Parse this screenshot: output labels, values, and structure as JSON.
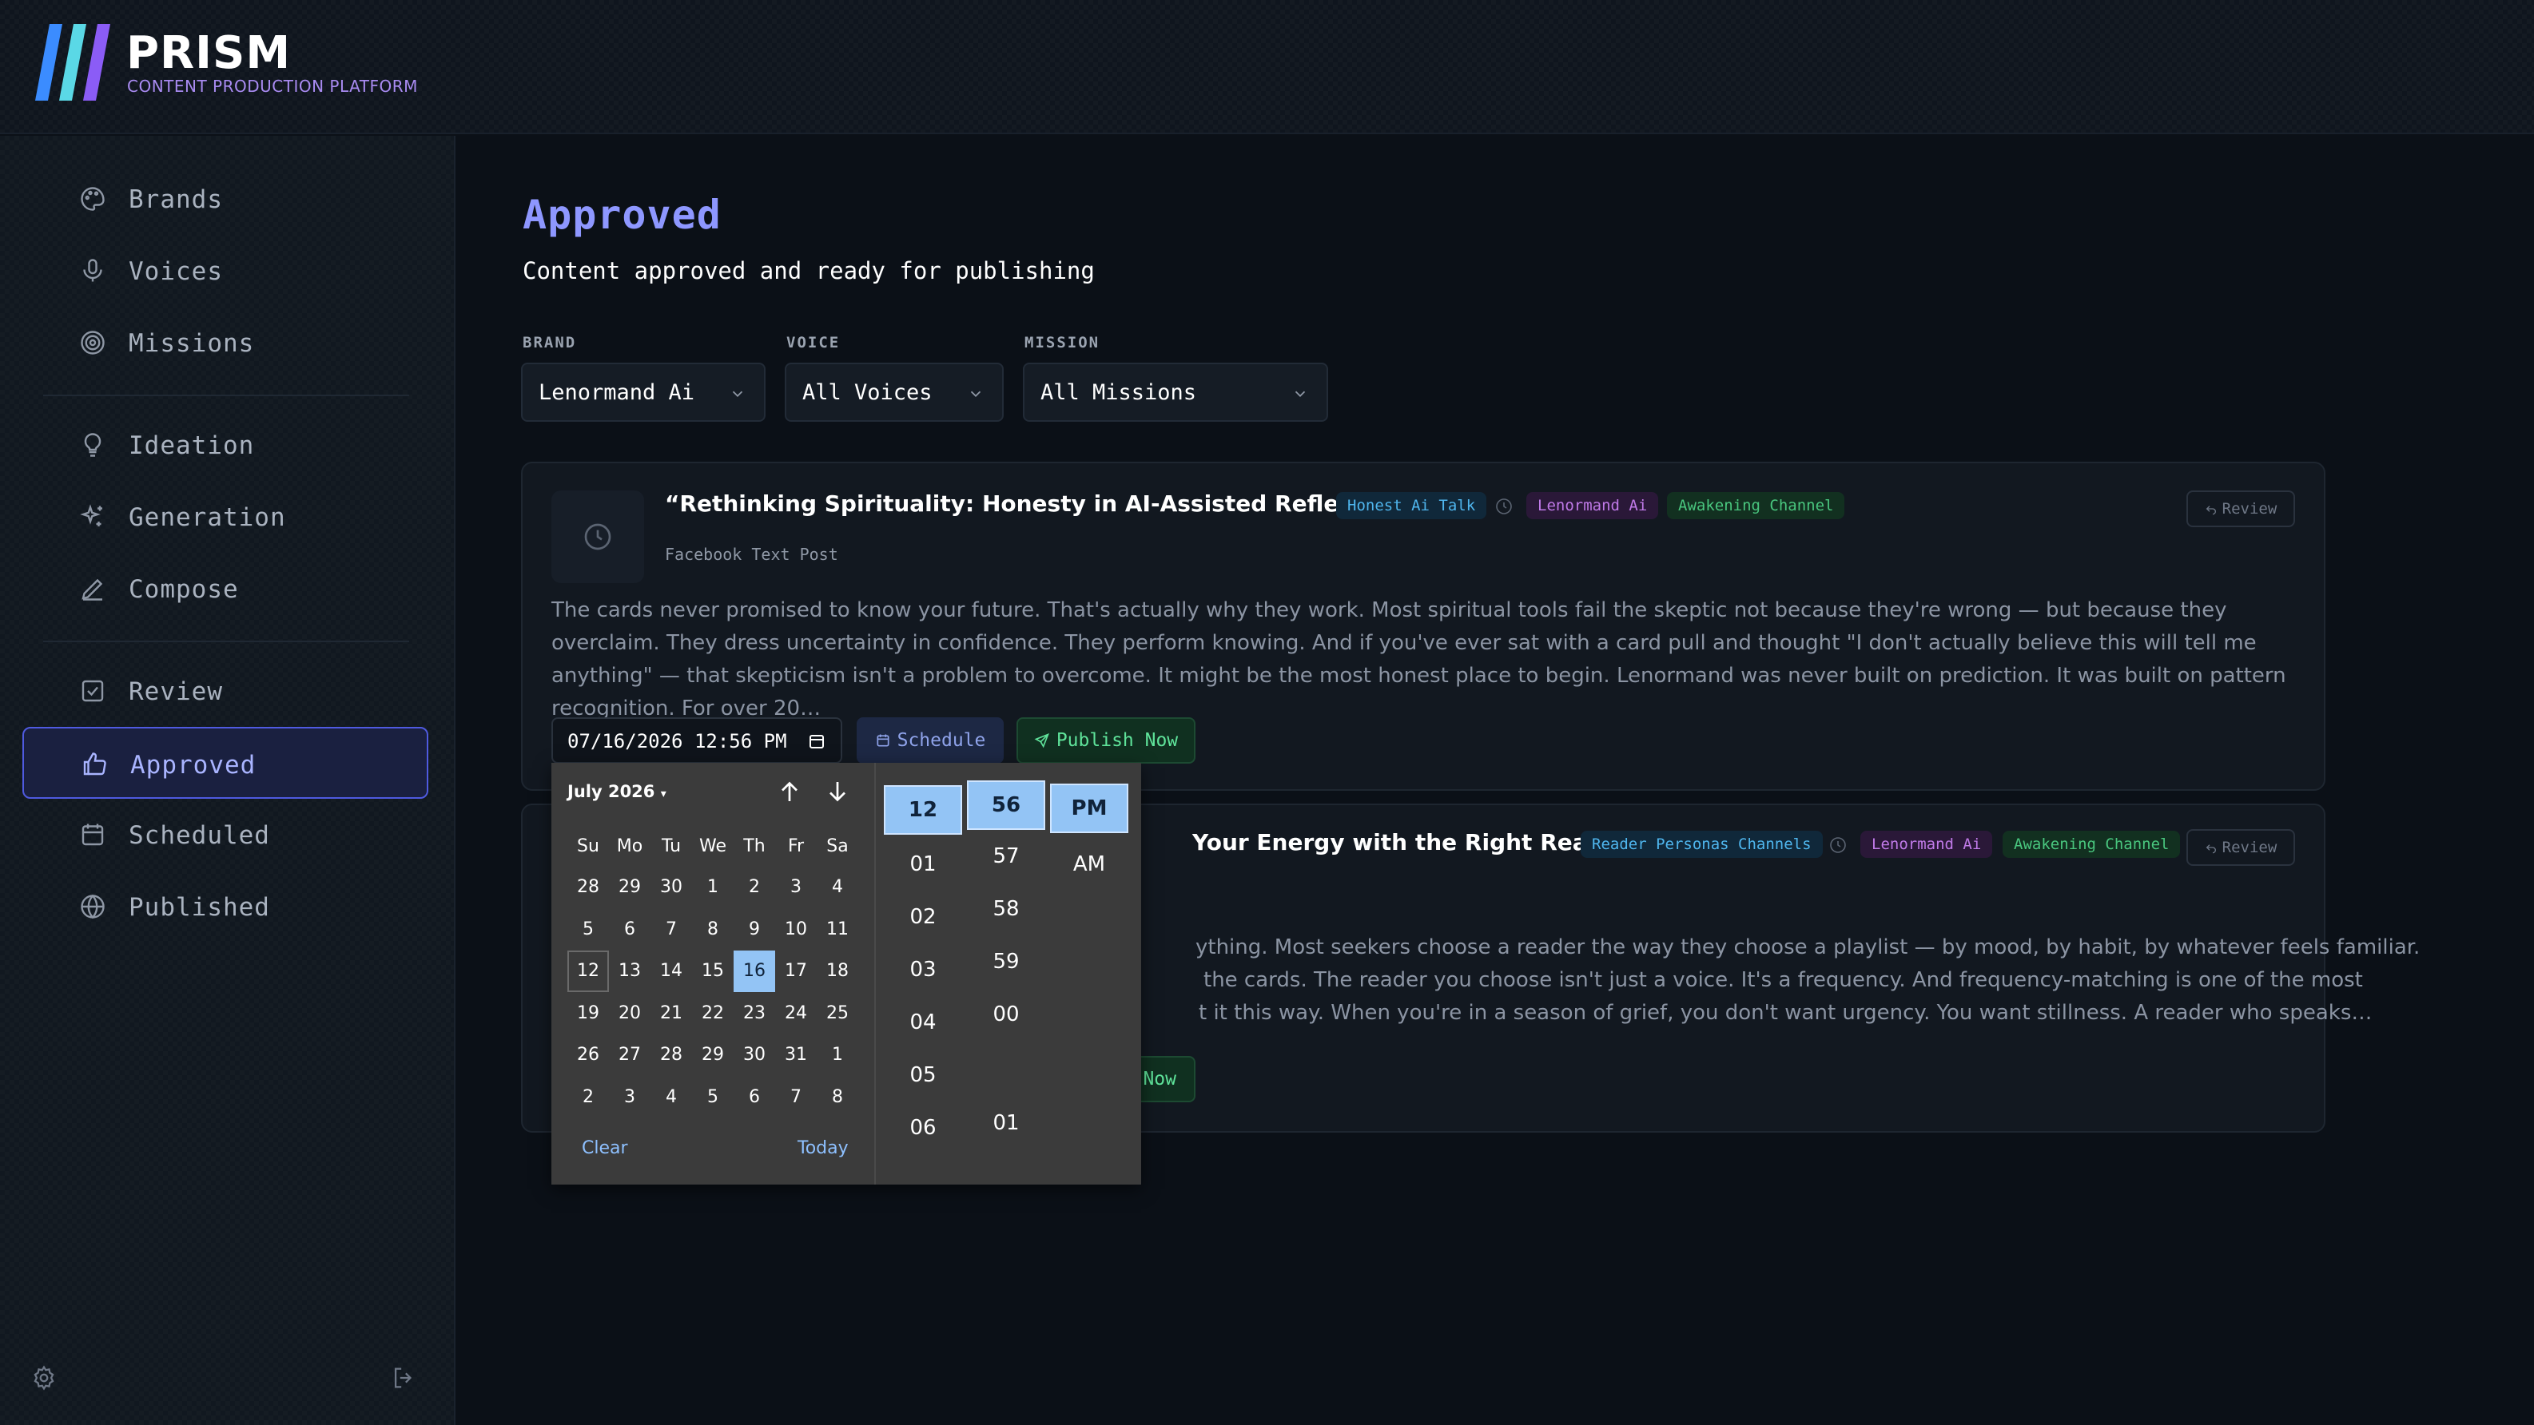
{
  "brand": {
    "title": "PRISM",
    "subtitle": "CONTENT PRODUCTION PLATFORM",
    "colors": [
      "#3b8cff",
      "#5ad8e6",
      "#8b5cf6"
    ]
  },
  "sidebar": {
    "items": [
      {
        "label": "Brands",
        "icon": "palette-icon"
      },
      {
        "label": "Voices",
        "icon": "microphone-icon"
      },
      {
        "label": "Missions",
        "icon": "target-icon"
      },
      {
        "label": "Ideation",
        "icon": "lightbulb-icon"
      },
      {
        "label": "Generation",
        "icon": "sparkles-icon"
      },
      {
        "label": "Compose",
        "icon": "pencil-icon"
      },
      {
        "label": "Review",
        "icon": "check-square-icon"
      },
      {
        "label": "Approved",
        "icon": "thumbs-up-icon",
        "active": true
      },
      {
        "label": "Scheduled",
        "icon": "calendar-icon"
      },
      {
        "label": "Published",
        "icon": "globe-icon"
      }
    ]
  },
  "page": {
    "title": "Approved",
    "subtitle": "Content approved and ready for publishing"
  },
  "filters": {
    "brand_label": "BRAND",
    "brand_value": "Lenormand Ai",
    "voice_label": "VOICE",
    "voice_value": "All Voices",
    "mission_label": "MISSION",
    "mission_value": "All Missions"
  },
  "cards": [
    {
      "title": "“Rethinking Spirituality: Honesty in AI-Assisted Reflections”",
      "tags": [
        "Honest Ai Talk",
        "Lenormand Ai",
        "Awakening Channel"
      ],
      "type": "Facebook Text Post",
      "body": "The cards never promised to know your future. That's actually why they work. Most spiritual tools fail the skeptic not because they're wrong — but because they overclaim. They dress uncertainty in confidence. They perform knowing. And if you've ever sat with a card pull and thought \"I don't actually believe this will tell me anything\" — that skepticism isn't a problem to overcome. It might be the most honest place to begin. Lenormand was never built on prediction. It was built on pattern recognition. For over 20…",
      "review_label": "Review",
      "datetime": "07/16/2026 12:56 PM",
      "schedule_label": "Schedule",
      "publish_label": "Publish Now"
    },
    {
      "title": "Your Energy with the Right Reader",
      "tags": [
        "Reader Personas Channels",
        "Lenormand Ai",
        "Awakening Channel"
      ],
      "body_lines": [
        "ything. Most seekers choose a reader the way they choose a playlist — by mood, by habit, by whatever feels familiar.",
        "the cards. The reader you choose isn't just a voice. It's a frequency. And frequency-matching is one of the most",
        "t it this way. When you're in a season of grief, you don't want urgency. You want stillness. A reader who speaks…"
      ],
      "review_label": "Review",
      "publish_partial": "Now"
    }
  ],
  "datepicker": {
    "month": "July 2026",
    "weekdays": [
      "Su",
      "Mo",
      "Tu",
      "We",
      "Th",
      "Fr",
      "Sa"
    ],
    "weeks": [
      [
        "28",
        "29",
        "30",
        "1",
        "2",
        "3",
        "4"
      ],
      [
        "5",
        "6",
        "7",
        "8",
        "9",
        "10",
        "11"
      ],
      [
        "12",
        "13",
        "14",
        "15",
        "16",
        "17",
        "18"
      ],
      [
        "19",
        "20",
        "21",
        "22",
        "23",
        "24",
        "25"
      ],
      [
        "26",
        "27",
        "28",
        "29",
        "30",
        "31",
        "1"
      ],
      [
        "2",
        "3",
        "4",
        "5",
        "6",
        "7",
        "8"
      ]
    ],
    "today_day": "12",
    "selected_day": "16",
    "clear_label": "Clear",
    "today_label": "Today",
    "hours": [
      "12",
      "01",
      "02",
      "03",
      "04",
      "05",
      "06"
    ],
    "minutes": [
      "56",
      "57",
      "58",
      "59",
      "00",
      "01"
    ],
    "meridiem": [
      "PM",
      "AM"
    ]
  }
}
